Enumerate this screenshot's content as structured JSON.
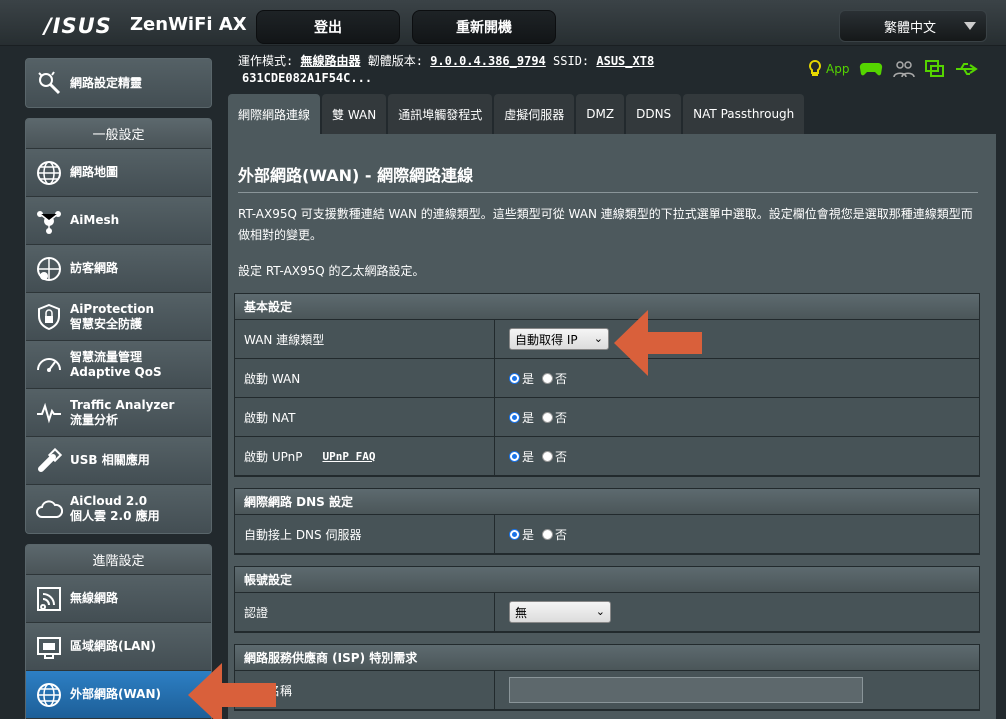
{
  "header": {
    "brand": "/ISUS",
    "product": "ZenWiFi AX",
    "logout": "登出",
    "reboot": "重新開機",
    "language": "繁體中文"
  },
  "info": {
    "mode_label": "運作模式:",
    "mode_value": "無線路由器",
    "firmware_label": "韌體版本:",
    "firmware_value": "9.0.0.4.386_9794",
    "ssid_label": "SSID:",
    "ssid_value": "ASUS_XT8",
    "mac": "631CDE082A1F54C...",
    "app_label": "App"
  },
  "sidebar": {
    "wizard": "網路設定精靈",
    "general_head": "一般設定",
    "general": [
      {
        "label": "網路地圖",
        "icon": "globe-icon"
      },
      {
        "label": "AiMesh",
        "icon": "mesh-icon"
      },
      {
        "label": "訪客網路",
        "icon": "guest-network-icon"
      },
      {
        "label": "AiProtection",
        "label2": "智慧安全防護",
        "icon": "lock-shield-icon"
      },
      {
        "label": "智慧流量管理",
        "label2": "Adaptive QoS",
        "icon": "gauge-icon"
      },
      {
        "label": "Traffic Analyzer",
        "label2": "流量分析",
        "icon": "wave-chart-icon"
      },
      {
        "label": "USB 相關應用",
        "icon": "usb-icon"
      },
      {
        "label": "AiCloud 2.0",
        "label2": "個人雲 2.0 應用",
        "icon": "cloud-icon"
      }
    ],
    "advanced_head": "進階設定",
    "advanced": [
      {
        "label": "無線網路",
        "icon": "wireless-icon"
      },
      {
        "label": "區域網路(LAN)",
        "icon": "lan-icon"
      },
      {
        "label": "外部網路(WAN)",
        "icon": "globe-icon"
      }
    ]
  },
  "tabs": [
    "網際網路連線",
    "雙 WAN",
    "通訊埠觸發程式",
    "虛擬伺服器",
    "DMZ",
    "DDNS",
    "NAT Passthrough"
  ],
  "main": {
    "title": "外部網路(WAN) - 網際網路連線",
    "description": "RT-AX95Q 可支援數種連結 WAN 的連線類型。這些類型可從 WAN 連線類型的下拉式選單中選取。設定欄位會視您是選取那種連線類型而做相對的變更。",
    "description2": "設定 RT-AX95Q 的乙太網路設定。",
    "basic_head": "基本設定",
    "wan_type_label": "WAN 連線類型",
    "wan_type_value": "自動取得 IP",
    "enable_wan": "啟動 WAN",
    "enable_nat": "啟動 NAT",
    "enable_upnp": "啟動 UPnP",
    "upnp_faq": "UPnP FAQ",
    "yes": "是",
    "no": "否",
    "dns_head": "網際網路 DNS 設定",
    "dns_auto": "自動接上 DNS 伺服器",
    "account_head": "帳號設定",
    "auth_label": "認證",
    "auth_value": "無",
    "isp_head": "網路服務供應商 (ISP) 特別需求",
    "host_label": "主機名稱"
  },
  "colors": {
    "arrow": "#d9603b",
    "active": "#2d7fc4",
    "icon_green": "#55d400"
  }
}
